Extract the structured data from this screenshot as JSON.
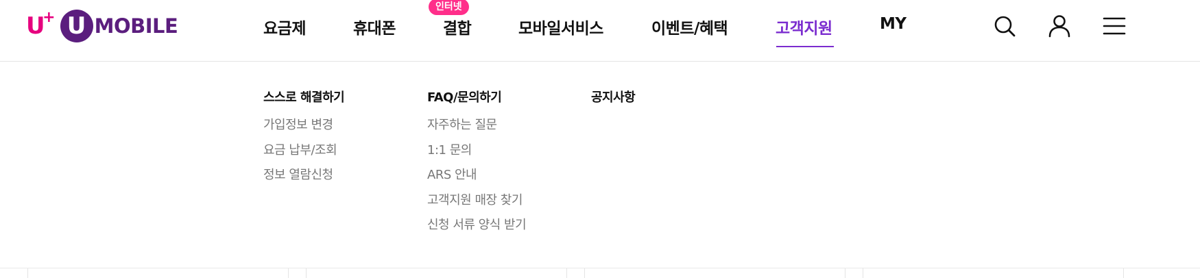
{
  "brand": {
    "logo_uplus": "U",
    "logo_plus": "+",
    "logo_circle": "U",
    "logo_text": "MOBILE"
  },
  "gnb": {
    "items": [
      {
        "label": "요금제"
      },
      {
        "label": "휴대폰"
      },
      {
        "label": "결합"
      },
      {
        "label": "모바일서비스"
      },
      {
        "label": "이벤트/혜택"
      },
      {
        "label": "고객지원",
        "active": true
      },
      {
        "label": "MY"
      }
    ],
    "badge": "인터넷"
  },
  "utility": {
    "search_icon": "search-icon",
    "user_icon": "user-icon",
    "menu_icon": "hamburger-menu-icon"
  },
  "mega_menu": {
    "columns": [
      {
        "title": "스스로 해결하기",
        "links": [
          "가입정보 변경",
          "요금 납부/조회",
          "정보 열람신청"
        ]
      },
      {
        "title": "FAQ/문의하기",
        "links": [
          "자주하는 질문",
          "1:1 문의",
          "ARS 안내",
          "고객지원 매장 찾기",
          "신청 서류 양식 받기"
        ]
      },
      {
        "title": "공지사항",
        "links": []
      }
    ]
  },
  "colors": {
    "brand_pink": "#e6007e",
    "brand_purple": "#5b1e7e",
    "active": "#7b2ccf",
    "badge": "#ff2e8a"
  }
}
